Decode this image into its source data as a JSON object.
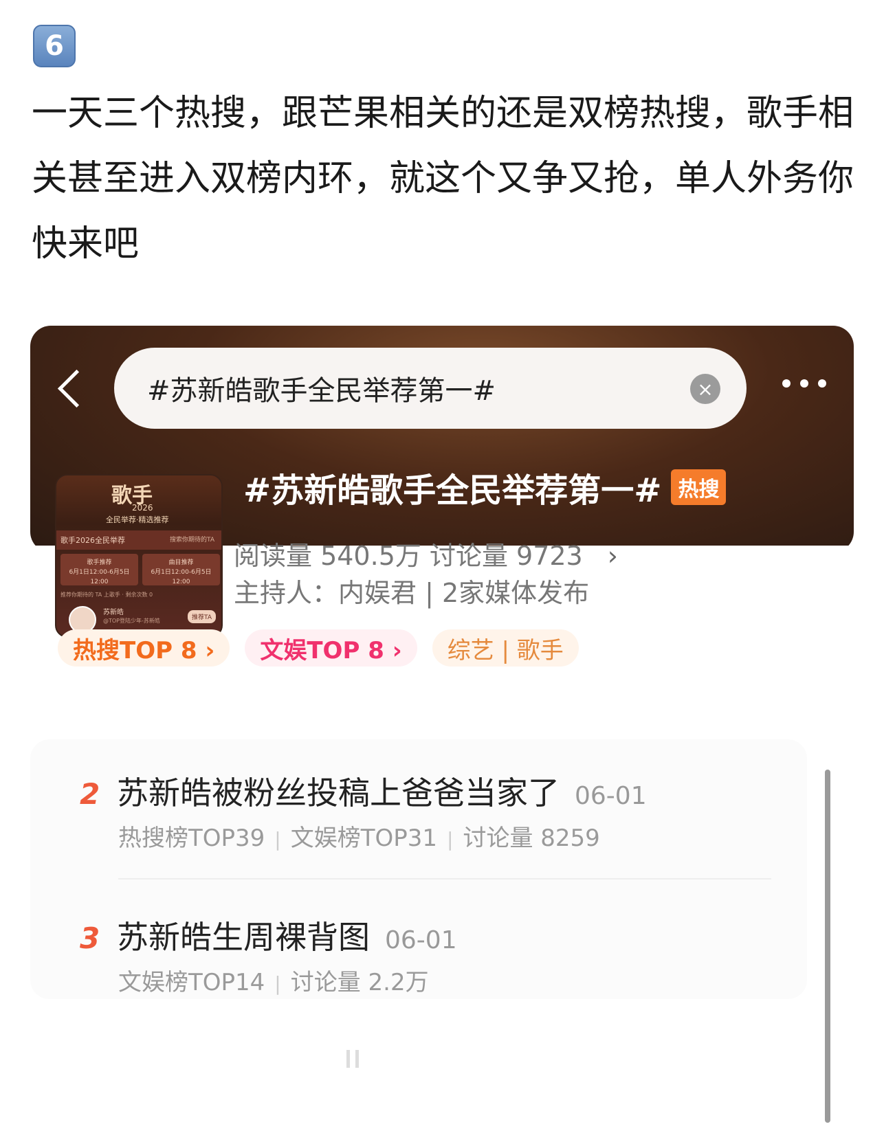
{
  "post": {
    "number_badge": "6",
    "text": "一天三个热搜，跟芒果相关的还是双榜热搜，歌手相关甚至进入双榜内环，就这个又争又抢，单人外务你快来吧"
  },
  "search": {
    "query": "#苏新皓歌手全民举荐第一#",
    "clear_glyph": "×"
  },
  "topic": {
    "title": "#苏新皓歌手全民举荐第一#",
    "badge": "热搜",
    "stats": "阅读量 540.5万  讨论量 9723",
    "stats_chevron": "›",
    "host": "主持人：内娱君 | 2家媒体发布"
  },
  "thumbnail": {
    "title": "歌手",
    "year": "2026",
    "subtitle": "全民举荐·精选推荐",
    "row_label": "歌手2026全民举荐",
    "row_right": "搜索你期待的TA",
    "card1": "歌手推荐\n6月1日12:00-6月5日12:00",
    "card2": "曲目推荐\n6月1日12:00-6月5日12:00",
    "line": "推荐你期待的 TA 上歌手 · 剩余次数 0",
    "name": "苏新皓",
    "handle": "@TOP登陆少年-苏新皓",
    "button": "推荐TA"
  },
  "tags": [
    "热搜TOP 8 ›",
    "文娱TOP 8 ›",
    "综艺 | 歌手"
  ],
  "items": [
    {
      "rank": "2",
      "title": "苏新皓被粉丝投稿上爸爸当家了",
      "date": "06-01",
      "meta": [
        "热搜榜TOP39",
        "文娱榜TOP31",
        "讨论量 8259"
      ]
    },
    {
      "rank": "3",
      "title": "苏新皓生周裸背图",
      "date": "06-01",
      "meta": [
        "文娱榜TOP14",
        "讨论量 2.2万"
      ]
    }
  ],
  "icons": {
    "back": "back-arrow-icon",
    "clear": "clear-icon",
    "more": "more-dots-icon"
  }
}
